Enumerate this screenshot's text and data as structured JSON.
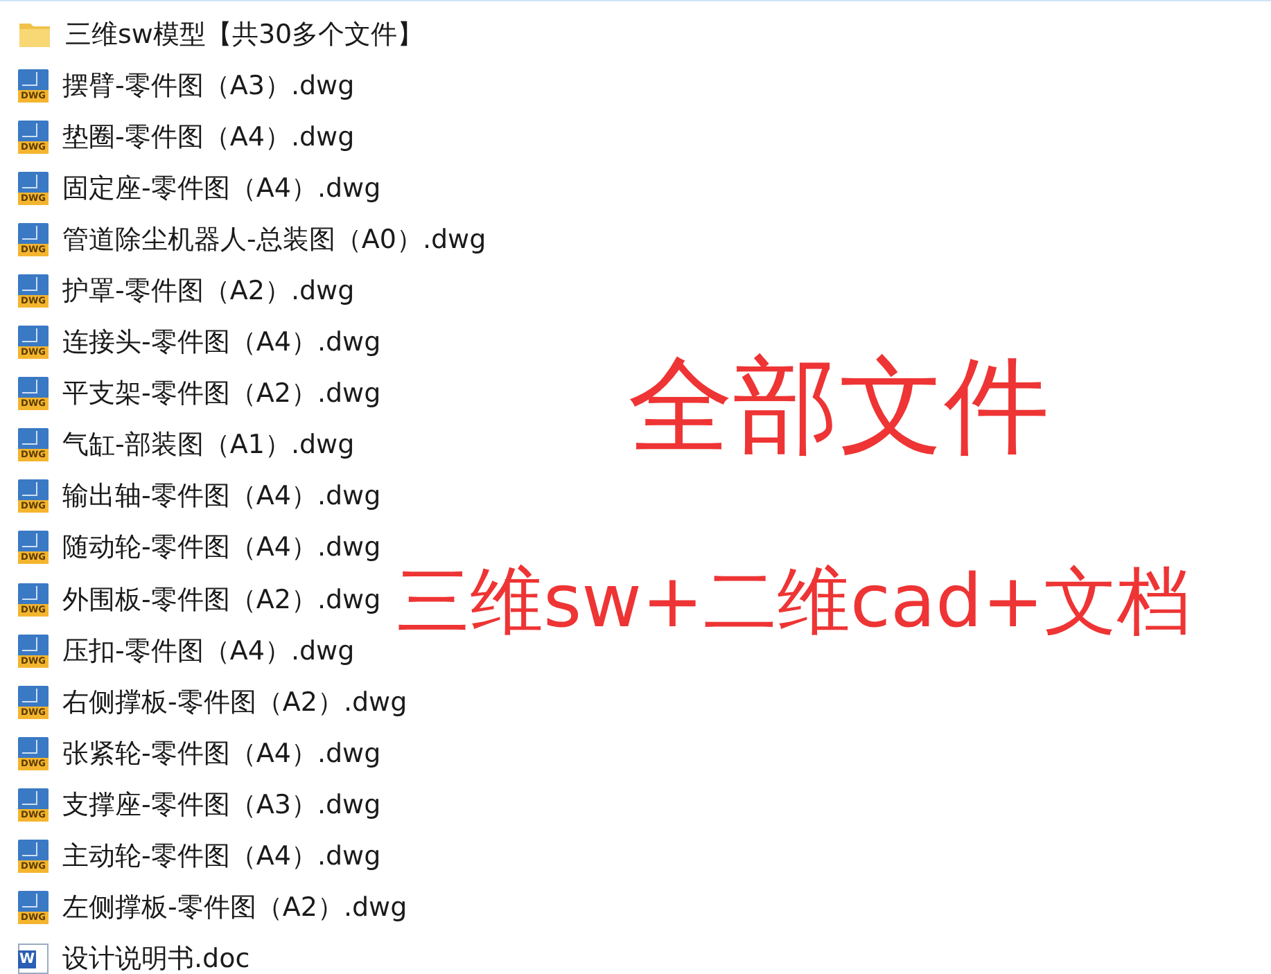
{
  "files": [
    {
      "kind": "folder",
      "name": "三维sw模型【共30多个文件】"
    },
    {
      "kind": "dwg",
      "icon_text": "DWG",
      "name": "摆臂-零件图（A3）.dwg"
    },
    {
      "kind": "dwg",
      "icon_text": "DWG",
      "name": "垫圈-零件图（A4）.dwg"
    },
    {
      "kind": "dwg",
      "icon_text": "DWG",
      "name": "固定座-零件图（A4）.dwg"
    },
    {
      "kind": "dwg",
      "icon_text": "DWG",
      "name": "管道除尘机器人-总装图（A0）.dwg"
    },
    {
      "kind": "dwg",
      "icon_text": "DWG",
      "name": "护罩-零件图（A2）.dwg"
    },
    {
      "kind": "dwg",
      "icon_text": "DWG",
      "name": "连接头-零件图（A4）.dwg"
    },
    {
      "kind": "dwg",
      "icon_text": "DWG",
      "name": "平支架-零件图（A2）.dwg"
    },
    {
      "kind": "dwg",
      "icon_text": "DWG",
      "name": "气缸-部装图（A1）.dwg"
    },
    {
      "kind": "dwg",
      "icon_text": "DWG",
      "name": "输出轴-零件图（A4）.dwg"
    },
    {
      "kind": "dwg",
      "icon_text": "DWG",
      "name": "随动轮-零件图（A4）.dwg"
    },
    {
      "kind": "dwg",
      "icon_text": "DWG",
      "name": "外围板-零件图（A2）.dwg"
    },
    {
      "kind": "dwg",
      "icon_text": "DWG",
      "name": "压扣-零件图（A4）.dwg"
    },
    {
      "kind": "dwg",
      "icon_text": "DWG",
      "name": "右侧撑板-零件图（A2）.dwg"
    },
    {
      "kind": "dwg",
      "icon_text": "DWG",
      "name": "张紧轮-零件图（A4）.dwg"
    },
    {
      "kind": "dwg",
      "icon_text": "DWG",
      "name": "支撑座-零件图（A3）.dwg"
    },
    {
      "kind": "dwg",
      "icon_text": "DWG",
      "name": "主动轮-零件图（A4）.dwg"
    },
    {
      "kind": "dwg",
      "icon_text": "DWG",
      "name": "左侧撑板-零件图（A2）.dwg"
    },
    {
      "kind": "doc",
      "icon_text": "W",
      "name": "设计说明书.doc"
    }
  ],
  "overlay": {
    "title": "全部文件",
    "subtitle": "三维sw+二维cad+文档"
  }
}
